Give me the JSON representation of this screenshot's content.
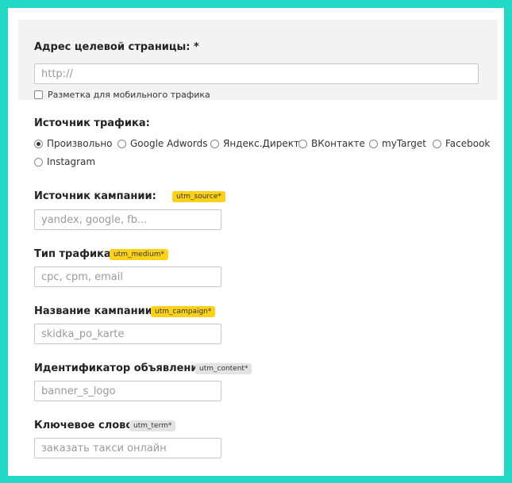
{
  "url_section": {
    "label": "Адрес целевой страницы: *",
    "placeholder": "http://",
    "mobile_checkbox_label": "Разметка для мобильного трафика"
  },
  "traffic_source": {
    "label": "Источник трафика:",
    "options": [
      "Произвольно",
      "Google Adwords",
      "Яндекс.Директ",
      "ВКонтакте",
      "myTarget",
      "Facebook",
      "Instagram"
    ],
    "selected": "Произвольно"
  },
  "fields": [
    {
      "label": "Источник кампании:",
      "tag": "utm_source*",
      "tag_color": "#fcd219",
      "placeholder": "yandex, google, fb..."
    },
    {
      "label": "Тип трафика:",
      "tag": "utm_medium*",
      "tag_color": "#fcd219",
      "placeholder": "cpc, cpm, email"
    },
    {
      "label": "Название кампании:",
      "tag": "utm_campaign*",
      "tag_color": "#fcd219",
      "placeholder": "skidka_po_karte"
    },
    {
      "label": "Идентификатор объявления:",
      "tag": "utm_content*",
      "tag_color": "#e3e3e3",
      "placeholder": "banner_s_logo"
    },
    {
      "label": "Ключевое слово:",
      "tag": "utm_term*",
      "tag_color": "#e3e3e3",
      "placeholder": "заказать такси онлайн"
    }
  ]
}
